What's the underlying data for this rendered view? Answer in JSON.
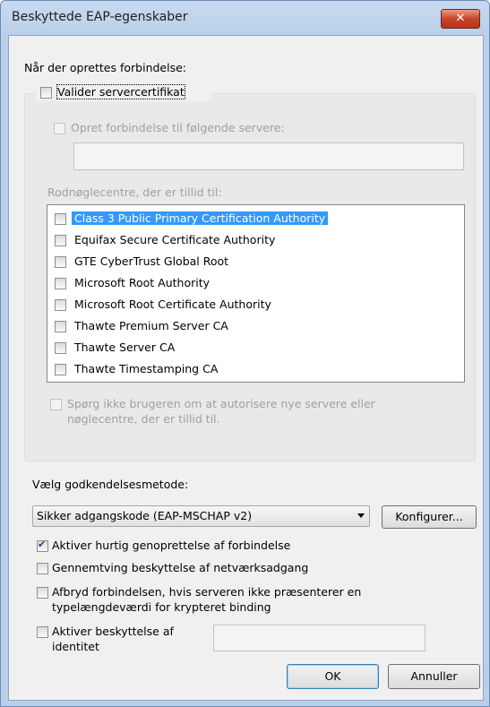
{
  "window": {
    "title": "Beskyttede EAP-egenskaber",
    "close_symbol": "✕"
  },
  "connect_section": {
    "label": "Når der oprettes forbindelse:"
  },
  "validate_cert": {
    "label": "Valider servercertifikat",
    "checked": false
  },
  "connect_servers": {
    "label": "Opret forbindelse til følgende servere:",
    "checked": false,
    "value": ""
  },
  "root_ca": {
    "label": "Rodnøglecentre, der er tillid til:",
    "items": [
      {
        "label": "Class 3 Public Primary Certification Authority",
        "checked": false,
        "selected": true
      },
      {
        "label": "Equifax Secure Certificate Authority",
        "checked": false
      },
      {
        "label": "GTE CyberTrust Global Root",
        "checked": false
      },
      {
        "label": "Microsoft Root Authority",
        "checked": false
      },
      {
        "label": "Microsoft Root Certificate Authority",
        "checked": false
      },
      {
        "label": "Thawte Premium Server CA",
        "checked": false
      },
      {
        "label": "Thawte Server CA",
        "checked": false
      },
      {
        "label": "Thawte Timestamping CA",
        "checked": false
      }
    ]
  },
  "dont_prompt": {
    "line1": "Spørg ikke brugeren om at autorisere nye servere eller",
    "line2": "nøglecentre, der er tillid til.",
    "checked": false
  },
  "auth_method": {
    "label": "Vælg godkendelsesmetode:",
    "selected": "Sikker adgangskode (EAP-MSCHAP v2)",
    "configure_label": "Konfigurer..."
  },
  "options": {
    "fast_reconnect": {
      "label": "Aktiver hurtig genoprettelse af forbindelse",
      "checked": true
    },
    "nap": {
      "label": "Gennemtving beskyttelse af netværksadgang",
      "checked": false
    },
    "disconnect": {
      "line1": "Afbryd forbindelsen, hvis serveren ikke præsenterer en",
      "line2": "typelængdeværdi for krypteret binding",
      "checked": false
    },
    "identity_privacy": {
      "line1": "Aktiver beskyttelse af",
      "line2": "identitet",
      "checked": false,
      "value": ""
    }
  },
  "buttons": {
    "ok": "OK",
    "cancel": "Annuller"
  }
}
